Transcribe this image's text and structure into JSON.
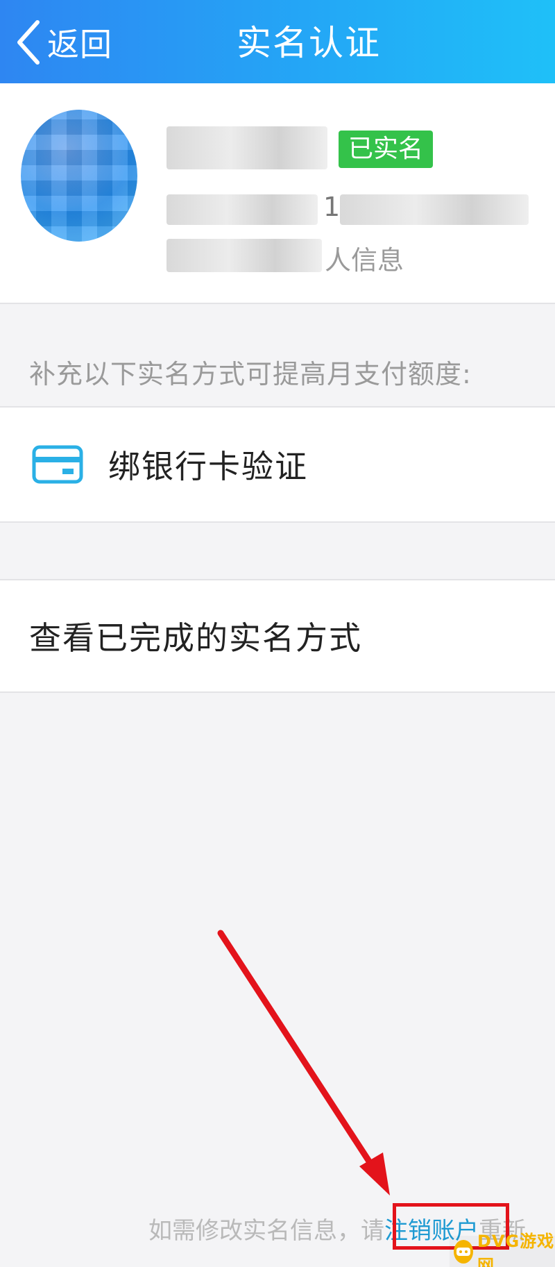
{
  "header": {
    "back_label": "返回",
    "title": "实名认证"
  },
  "profile": {
    "status_badge": "已实名",
    "visible_char": "1",
    "info_tail": "人信息"
  },
  "hint": "补充以下实名方式可提高月支付额度:",
  "options": {
    "bank_card": "绑银行卡验证",
    "view_completed": "查看已完成的实名方式"
  },
  "footer": {
    "prefix": "如需修改实名信息，请",
    "link": "注销账户",
    "suffix": "重新"
  },
  "watermark": {
    "text": "DVG游戏网"
  },
  "colors": {
    "header_start": "#2e86f2",
    "header_end": "#1fc0f8",
    "badge_green": "#34c24a",
    "link_blue": "#1e9ad2",
    "annotation_red": "#e3131b"
  },
  "icons": {
    "back": "chevron-left-icon",
    "card": "bank-card-icon"
  }
}
